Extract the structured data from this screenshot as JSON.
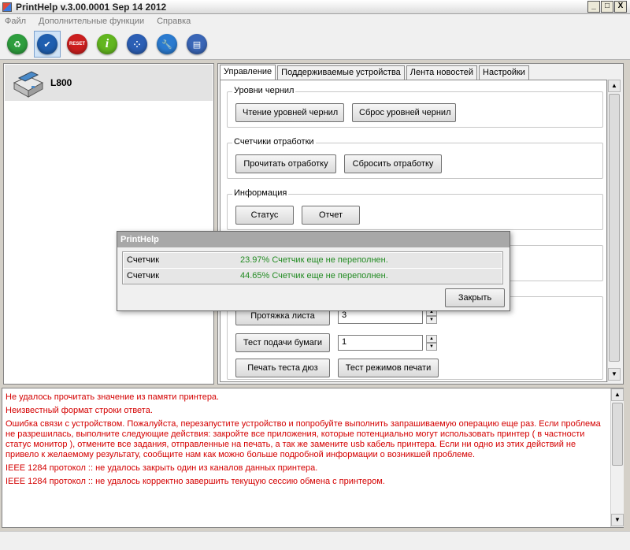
{
  "window": {
    "title": "PrintHelp v.3.00.0001 Sep 14 2012",
    "minimize": "_",
    "maximize": "□",
    "close": "X"
  },
  "menu": [
    "Файл",
    "Дополнительные функции",
    "Справка"
  ],
  "toolbar": [
    {
      "icon": "recycle-icon",
      "color": "#2e9e3e"
    },
    {
      "icon": "check-icon",
      "color": "#1f5fb0",
      "active": true
    },
    {
      "icon": "reset-icon",
      "color": "#cc1f1f",
      "label": "RESET"
    },
    {
      "icon": "info-icon",
      "color": "#62b61f"
    },
    {
      "icon": "network-icon",
      "color": "#2c5fb5"
    },
    {
      "icon": "wrench-icon",
      "color": "#2b7bd0"
    },
    {
      "icon": "book-icon",
      "color": "#3a66b7"
    }
  ],
  "printer": {
    "name": "L800"
  },
  "tabs": [
    "Управление",
    "Поддерживаемые устройства",
    "Лента новостей",
    "Настройки"
  ],
  "groups": {
    "ink": {
      "title": "Уровни чернил",
      "read": "Чтение уровней чернил",
      "reset": "Сброс уровней чернил"
    },
    "counters": {
      "title": "Счетчики отработки",
      "read": "Прочитать отработку",
      "reset": "Сбросить отработку"
    },
    "info": {
      "title": "Информация",
      "status": "Статус",
      "report": "Отчет"
    },
    "tests": {
      "feed_label": "Протяжка листа",
      "feed_value": "3",
      "paper_label": "Тест подачи бумаги",
      "paper_value": "1",
      "nozzle": "Печать теста дюз",
      "modes": "Тест режимов печати"
    }
  },
  "dialog": {
    "title": "PrintHelp",
    "rows": [
      {
        "name": "Счетчик",
        "value": "23.97% Счетчик еще не переполнен."
      },
      {
        "name": "Счетчик",
        "value": "44.65% Счетчик еще не переполнен."
      }
    ],
    "close": "Закрыть"
  },
  "log": [
    "Не удалось прочитать значение из памяти принтера.",
    "Неизвестный формат строки ответа.",
    "Ошибка связи с устройством. Пожалуйста, перезапустите устройство и попробуйте выполнить запрашиваемую операцию еще раз. Если проблема не разрешилась, выполните следующие действия: закройте все приложения, которые потенциально могут использовать принтер ( в частности статус монитор ), отмените все задания, отправленные на печать, а так же замените usb кабель принтера. Если ни одно из этих действий не привело к желаемому результату, сообщите нам как можно больше подробной информации о возникшей проблеме.",
    "IEEE 1284 протокол :: не удалось закрыть один из каналов данных принтера.",
    "IEEE 1284 протокол :: не удалось корректно завершить текущую сессию обмена с принтером."
  ]
}
